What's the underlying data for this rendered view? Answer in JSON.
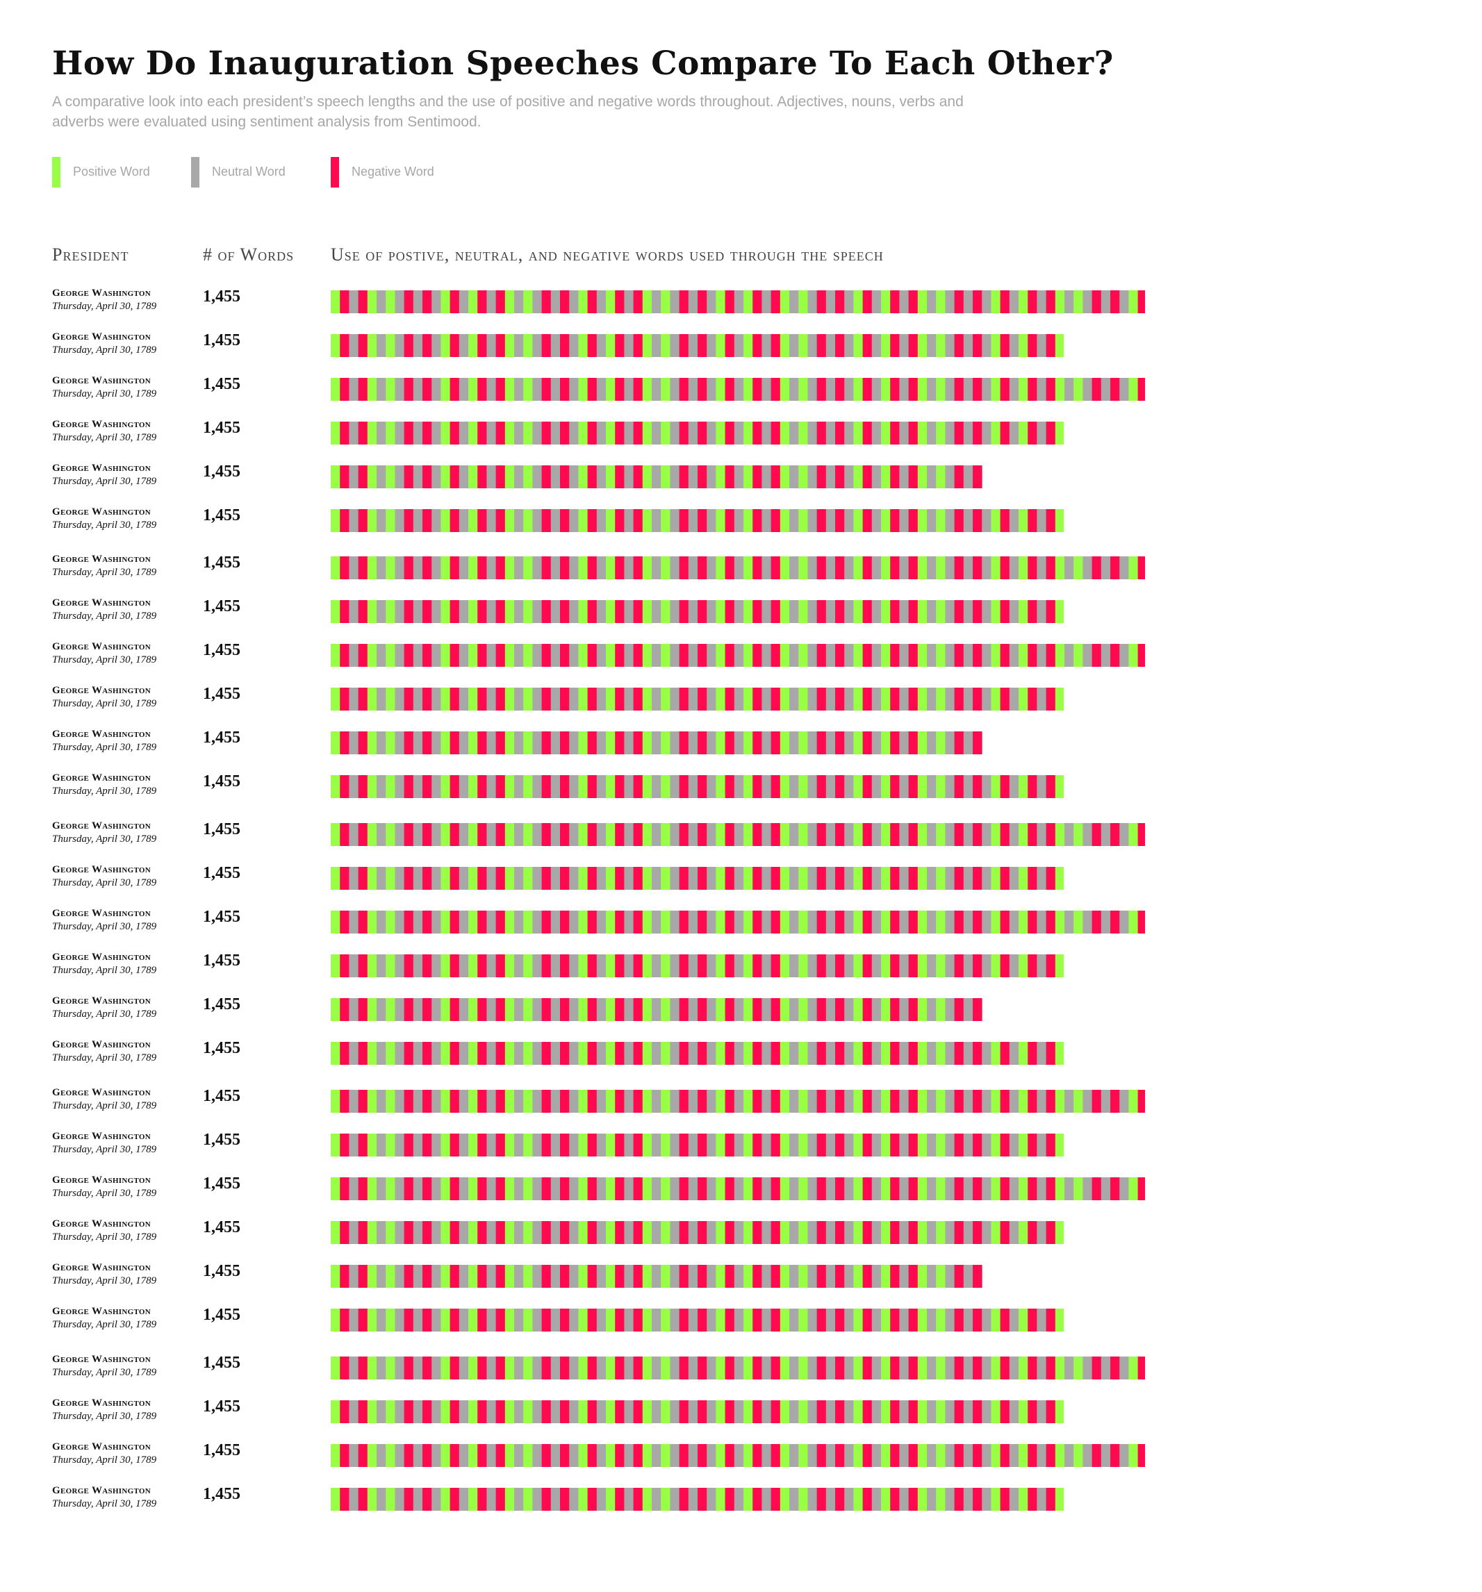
{
  "header": {
    "title": "How Do Inauguration Speeches Compare To Each Other?",
    "subtitle": "A comparative look into each president’s speech lengths and the use of positive and negative words throughout. Adjectives, nouns, verbs and adverbs were evaluated using sentiment analysis from Sentimood."
  },
  "legend": [
    {
      "label": "Positive Word",
      "color": "#99ff44"
    },
    {
      "label": "Neutral Word",
      "color": "#a8a8a8"
    },
    {
      "label": "Negative Word",
      "color": "#ff0a4f"
    }
  ],
  "columns": {
    "president": "President",
    "words": "# of Words",
    "usage": "Use of postive, neutral, and negative words used through the speech"
  },
  "chart_data": {
    "type": "bar",
    "colors": {
      "positive": "#99ff44",
      "neutral": "#a8a8a8",
      "negative": "#ff0a4f"
    },
    "pattern": [
      "positive",
      "negative",
      "neutral",
      "negative",
      "positive",
      "neutral",
      "positive",
      "neutral",
      "negative",
      "neutral",
      "negative",
      "neutral",
      "positive",
      "negative",
      "neutral"
    ],
    "rows": [
      {
        "president": "George Washington",
        "date": "Thursday, April 30, 1789",
        "words": "1,455",
        "length": 1.0
      },
      {
        "president": "George Washington",
        "date": "Thursday, April 30, 1789",
        "words": "1,455",
        "length": 0.9
      },
      {
        "president": "George Washington",
        "date": "Thursday, April 30, 1789",
        "words": "1,455",
        "length": 1.0
      },
      {
        "president": "George Washington",
        "date": "Thursday, April 30, 1789",
        "words": "1,455",
        "length": 0.9
      },
      {
        "president": "George Washington",
        "date": "Thursday, April 30, 1789",
        "words": "1,455",
        "length": 0.8
      },
      {
        "president": "George Washington",
        "date": "Thursday, April 30, 1789",
        "words": "1,455",
        "length": 0.9
      },
      {
        "president": "George Washington",
        "date": "Thursday, April 30, 1789",
        "words": "1,455",
        "length": 1.0
      },
      {
        "president": "George Washington",
        "date": "Thursday, April 30, 1789",
        "words": "1,455",
        "length": 0.9
      },
      {
        "president": "George Washington",
        "date": "Thursday, April 30, 1789",
        "words": "1,455",
        "length": 1.0
      },
      {
        "president": "George Washington",
        "date": "Thursday, April 30, 1789",
        "words": "1,455",
        "length": 0.9
      },
      {
        "president": "George Washington",
        "date": "Thursday, April 30, 1789",
        "words": "1,455",
        "length": 0.8
      },
      {
        "president": "George Washington",
        "date": "Thursday, April 30, 1789",
        "words": "1,455",
        "length": 0.9
      },
      {
        "president": "George Washington",
        "date": "Thursday, April 30, 1789",
        "words": "1,455",
        "length": 1.0
      },
      {
        "president": "George Washington",
        "date": "Thursday, April 30, 1789",
        "words": "1,455",
        "length": 0.9
      },
      {
        "president": "George Washington",
        "date": "Thursday, April 30, 1789",
        "words": "1,455",
        "length": 1.0
      },
      {
        "president": "George Washington",
        "date": "Thursday, April 30, 1789",
        "words": "1,455",
        "length": 0.9
      },
      {
        "president": "George Washington",
        "date": "Thursday, April 30, 1789",
        "words": "1,455",
        "length": 0.8
      },
      {
        "president": "George Washington",
        "date": "Thursday, April 30, 1789",
        "words": "1,455",
        "length": 0.9
      },
      {
        "president": "George Washington",
        "date": "Thursday, April 30, 1789",
        "words": "1,455",
        "length": 1.0
      },
      {
        "president": "George Washington",
        "date": "Thursday, April 30, 1789",
        "words": "1,455",
        "length": 0.9
      },
      {
        "president": "George Washington",
        "date": "Thursday, April 30, 1789",
        "words": "1,455",
        "length": 1.0
      },
      {
        "president": "George Washington",
        "date": "Thursday, April 30, 1789",
        "words": "1,455",
        "length": 0.9
      },
      {
        "president": "George Washington",
        "date": "Thursday, April 30, 1789",
        "words": "1,455",
        "length": 0.8
      },
      {
        "president": "George Washington",
        "date": "Thursday, April 30, 1789",
        "words": "1,455",
        "length": 0.9
      },
      {
        "president": "George Washington",
        "date": "Thursday, April 30, 1789",
        "words": "1,455",
        "length": 1.0
      },
      {
        "president": "George Washington",
        "date": "Thursday, April 30, 1789",
        "words": "1,455",
        "length": 0.9
      },
      {
        "president": "George Washington",
        "date": "Thursday, April 30, 1789",
        "words": "1,455",
        "length": 1.0
      },
      {
        "president": "George Washington",
        "date": "Thursday, April 30, 1789",
        "words": "1,455",
        "length": 0.9
      }
    ]
  }
}
